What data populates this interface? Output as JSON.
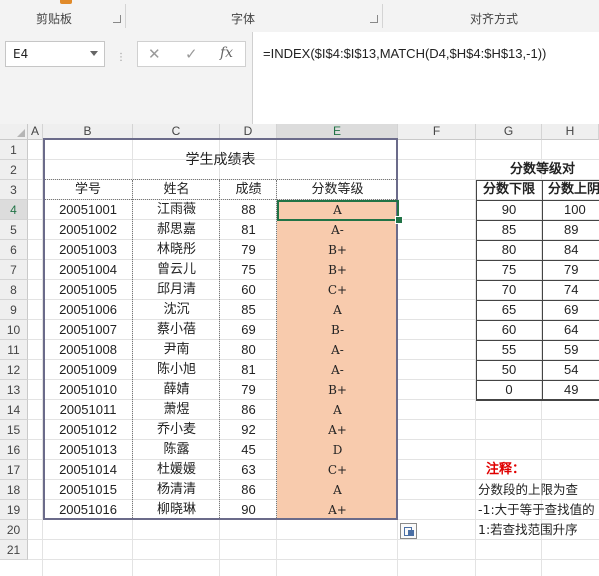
{
  "ribbon": {
    "groups": [
      "剪贴板",
      "字体",
      "对齐方式"
    ]
  },
  "formula_bar": {
    "name_box": "E4",
    "cancel_icon": "✕",
    "enter_icon": "✓",
    "fx_label": "fx",
    "formula": "=INDEX($I$4:$I$13,MATCH(D4,$H$4:$H$13,-1))"
  },
  "columns": [
    "A",
    "B",
    "C",
    "D",
    "E",
    "F",
    "G",
    "H"
  ],
  "rows": [
    "1",
    "2",
    "3",
    "4",
    "5",
    "6",
    "7",
    "8",
    "9",
    "10",
    "11",
    "12",
    "13",
    "14",
    "15",
    "16",
    "17",
    "18",
    "19",
    "20",
    "21"
  ],
  "table": {
    "title": "学生成绩表",
    "headers": [
      "学号",
      "姓名",
      "成绩",
      "分数等级"
    ],
    "records": [
      [
        "20051001",
        "江雨薇",
        "88",
        "A"
      ],
      [
        "20051002",
        "郝思嘉",
        "81",
        "A-"
      ],
      [
        "20051003",
        "林晓彤",
        "79",
        "B+"
      ],
      [
        "20051004",
        "曾云儿",
        "75",
        "B+"
      ],
      [
        "20051005",
        "邱月清",
        "60",
        "C+"
      ],
      [
        "20051006",
        "沈沉",
        "85",
        "A"
      ],
      [
        "20051007",
        "蔡小蓓",
        "69",
        "B-"
      ],
      [
        "20051008",
        "尹南",
        "80",
        "A-"
      ],
      [
        "20051009",
        "陈小旭",
        "81",
        "A-"
      ],
      [
        "20051010",
        "薛婧",
        "79",
        "B+"
      ],
      [
        "20051011",
        "萧煜",
        "86",
        "A"
      ],
      [
        "20051012",
        "乔小麦",
        "92",
        "A+"
      ],
      [
        "20051013",
        "陈露",
        "45",
        "D"
      ],
      [
        "20051014",
        "杜媛媛",
        "63",
        "C+"
      ],
      [
        "20051015",
        "杨清清",
        "86",
        "A"
      ],
      [
        "20051016",
        "柳晓琳",
        "90",
        "A+"
      ]
    ]
  },
  "lookup": {
    "title": "分数等级对",
    "headers": [
      "分数下限",
      "分数上阴"
    ],
    "rows": [
      [
        "90",
        "100"
      ],
      [
        "85",
        "89"
      ],
      [
        "80",
        "84"
      ],
      [
        "75",
        "79"
      ],
      [
        "70",
        "74"
      ],
      [
        "65",
        "69"
      ],
      [
        "60",
        "64"
      ],
      [
        "55",
        "59"
      ],
      [
        "50",
        "54"
      ],
      [
        "0",
        "49"
      ]
    ]
  },
  "notes": {
    "title": "注释：",
    "lines": [
      "分数段的上限为查",
      "-1:大于等于查找值的",
      "1:若查找范围升序"
    ]
  },
  "colors": {
    "grade_fill": "#f8cbad",
    "selection": "#217346",
    "note_title": "#e00000"
  }
}
